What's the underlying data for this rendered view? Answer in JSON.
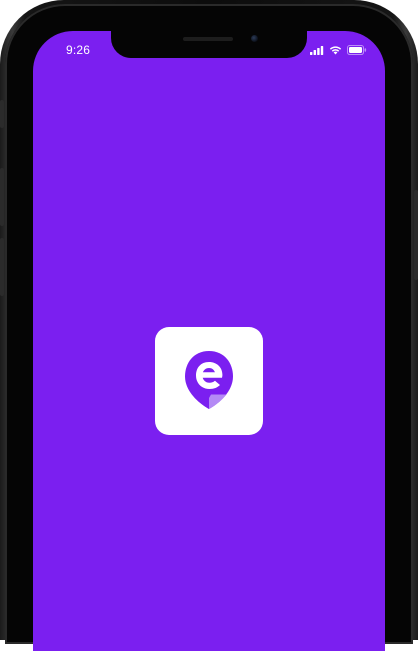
{
  "status_bar": {
    "time": "9:26",
    "icons": [
      "cellular-signal-icon",
      "wifi-icon",
      "battery-icon"
    ]
  },
  "splash": {
    "logo_icon": "e-location-pin-logo-icon"
  },
  "colors": {
    "background": "#7b1ff0",
    "logo_tile": "#ffffff",
    "logo_accent": "#7b1ff0",
    "logo_accent_light": "#b48af5"
  }
}
